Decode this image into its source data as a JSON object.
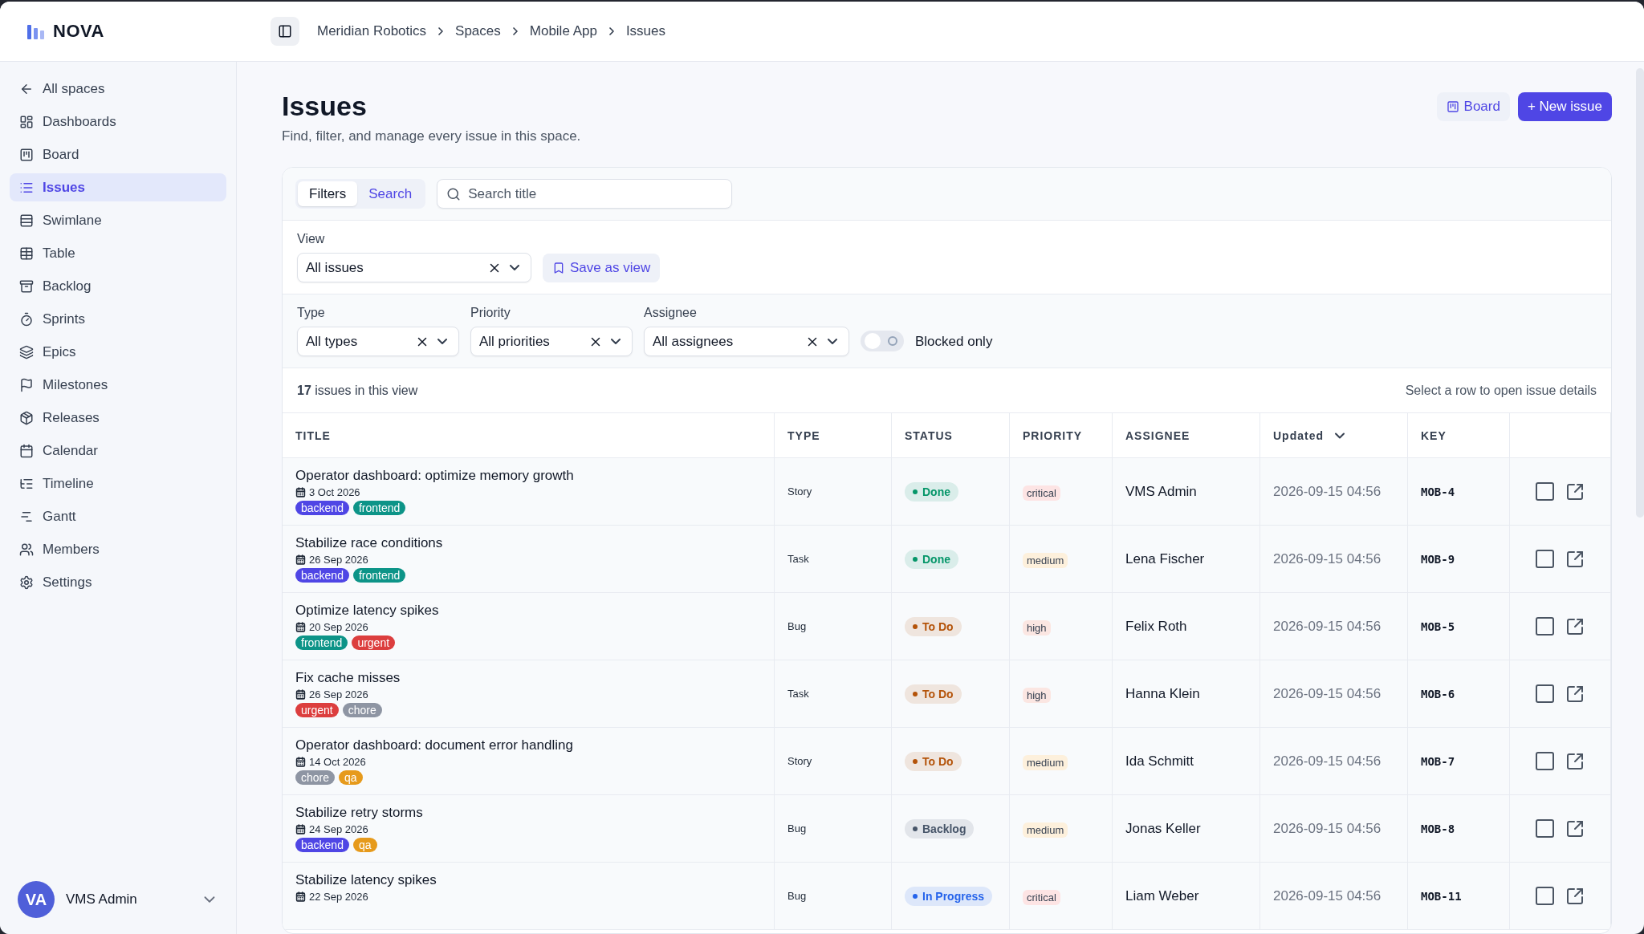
{
  "brand": {
    "name": "NOVA"
  },
  "breadcrumbs": [
    "Meridian Robotics",
    "Spaces",
    "Mobile App",
    "Issues"
  ],
  "sidebar": {
    "back": "All spaces",
    "items": [
      {
        "label": "Dashboards",
        "selected": false
      },
      {
        "label": "Board",
        "selected": false
      },
      {
        "label": "Issues",
        "selected": true
      },
      {
        "label": "Swimlane",
        "selected": false
      },
      {
        "label": "Table",
        "selected": false
      },
      {
        "label": "Backlog",
        "selected": false
      },
      {
        "label": "Sprints",
        "selected": false
      },
      {
        "label": "Epics",
        "selected": false
      },
      {
        "label": "Milestones",
        "selected": false
      },
      {
        "label": "Releases",
        "selected": false
      },
      {
        "label": "Calendar",
        "selected": false
      },
      {
        "label": "Timeline",
        "selected": false
      },
      {
        "label": "Gantt",
        "selected": false
      },
      {
        "label": "Members",
        "selected": false
      },
      {
        "label": "Settings",
        "selected": false
      }
    ],
    "user": {
      "initials": "VA",
      "name": "VMS Admin"
    }
  },
  "page": {
    "title": "Issues",
    "subtitle": "Find, filter, and manage every issue in this space.",
    "board_button": "Board",
    "new_button": "+ New issue"
  },
  "mode_tabs": [
    {
      "label": "Filters",
      "selected": true
    },
    {
      "label": "Search",
      "selected": false
    }
  ],
  "search": {
    "placeholder": "Search title"
  },
  "view": {
    "label": "View",
    "value": "All issues",
    "save": "Save as view"
  },
  "filters": [
    {
      "label": "Type",
      "value": "All types"
    },
    {
      "label": "Priority",
      "value": "All priorities"
    },
    {
      "label": "Assignee",
      "value": "All assignees"
    }
  ],
  "blocked_toggle": {
    "label": "Blocked only",
    "on": false
  },
  "summary": {
    "count": "17",
    "text": "issues in this view",
    "hint": "Select a row to open issue details"
  },
  "table": {
    "columns": [
      "TITLE",
      "TYPE",
      "STATUS",
      "PRIORITY",
      "ASSIGNEE",
      "Updated",
      "KEY"
    ],
    "rows": [
      {
        "title": "Operator dashboard: optimize memory growth",
        "date": "3 Oct 2026",
        "tags": [
          {
            "label": "backend",
            "color": "#4f46e5"
          },
          {
            "label": "frontend",
            "color": "#0d9488"
          }
        ],
        "type": "Story",
        "status": {
          "label": "Done",
          "color": "#059669"
        },
        "priority": {
          "label": "critical",
          "color": "#fde4e4"
        },
        "assignee": "VMS Admin",
        "updated": "2026-09-15 04:56",
        "key": "MOB-4",
        "checked": false
      },
      {
        "title": "Stabilize race conditions",
        "date": "26 Sep 2026",
        "tags": [
          {
            "label": "backend",
            "color": "#4f46e5"
          },
          {
            "label": "frontend",
            "color": "#0d9488"
          }
        ],
        "type": "Task",
        "status": {
          "label": "Done",
          "color": "#059669"
        },
        "priority": {
          "label": "medium",
          "color": "#fdf0dc"
        },
        "assignee": "Lena Fischer",
        "updated": "2026-09-15 04:56",
        "key": "MOB-9",
        "checked": false
      },
      {
        "title": "Optimize latency spikes",
        "date": "20 Sep 2026",
        "tags": [
          {
            "label": "frontend",
            "color": "#0d9488"
          },
          {
            "label": "urgent",
            "color": "#dc3e3e"
          }
        ],
        "type": "Bug",
        "status": {
          "label": "To Do",
          "color": "#b45309"
        },
        "priority": {
          "label": "high",
          "color": "#fbe6e2"
        },
        "assignee": "Felix Roth",
        "updated": "2026-09-15 04:56",
        "key": "MOB-5",
        "checked": false
      },
      {
        "title": "Fix cache misses",
        "date": "26 Sep 2026",
        "tags": [
          {
            "label": "urgent",
            "color": "#dc3e3e"
          },
          {
            "label": "chore",
            "color": "#8e95a3"
          }
        ],
        "type": "Task",
        "status": {
          "label": "To Do",
          "color": "#b45309"
        },
        "priority": {
          "label": "high",
          "color": "#fbe6e2"
        },
        "assignee": "Hanna Klein",
        "updated": "2026-09-15 04:56",
        "key": "MOB-6",
        "checked": false
      },
      {
        "title": "Operator dashboard: document error handling",
        "date": "14 Oct 2026",
        "tags": [
          {
            "label": "chore",
            "color": "#8e95a3"
          },
          {
            "label": "qa",
            "color": "#e69a1c"
          }
        ],
        "type": "Story",
        "status": {
          "label": "To Do",
          "color": "#b45309"
        },
        "priority": {
          "label": "medium",
          "color": "#fdf0dc"
        },
        "assignee": "Ida Schmitt",
        "updated": "2026-09-15 04:56",
        "key": "MOB-7",
        "checked": false
      },
      {
        "title": "Stabilize retry storms",
        "date": "24 Sep 2026",
        "tags": [
          {
            "label": "backend",
            "color": "#4f46e5"
          },
          {
            "label": "qa",
            "color": "#e69a1c"
          }
        ],
        "type": "Bug",
        "status": {
          "label": "Backlog",
          "color": "#475569"
        },
        "priority": {
          "label": "medium",
          "color": "#fdf0dc"
        },
        "assignee": "Jonas Keller",
        "updated": "2026-09-15 04:56",
        "key": "MOB-8",
        "checked": false
      },
      {
        "title": "Stabilize latency spikes",
        "date": "22 Sep 2026",
        "tags": [],
        "type": "Bug",
        "status": {
          "label": "In Progress",
          "color": "#2563eb"
        },
        "priority": {
          "label": "critical",
          "color": "#fde4e4"
        },
        "assignee": "Liam Weber",
        "updated": "2026-09-15 04:56",
        "key": "MOB-11",
        "checked": false
      }
    ]
  }
}
